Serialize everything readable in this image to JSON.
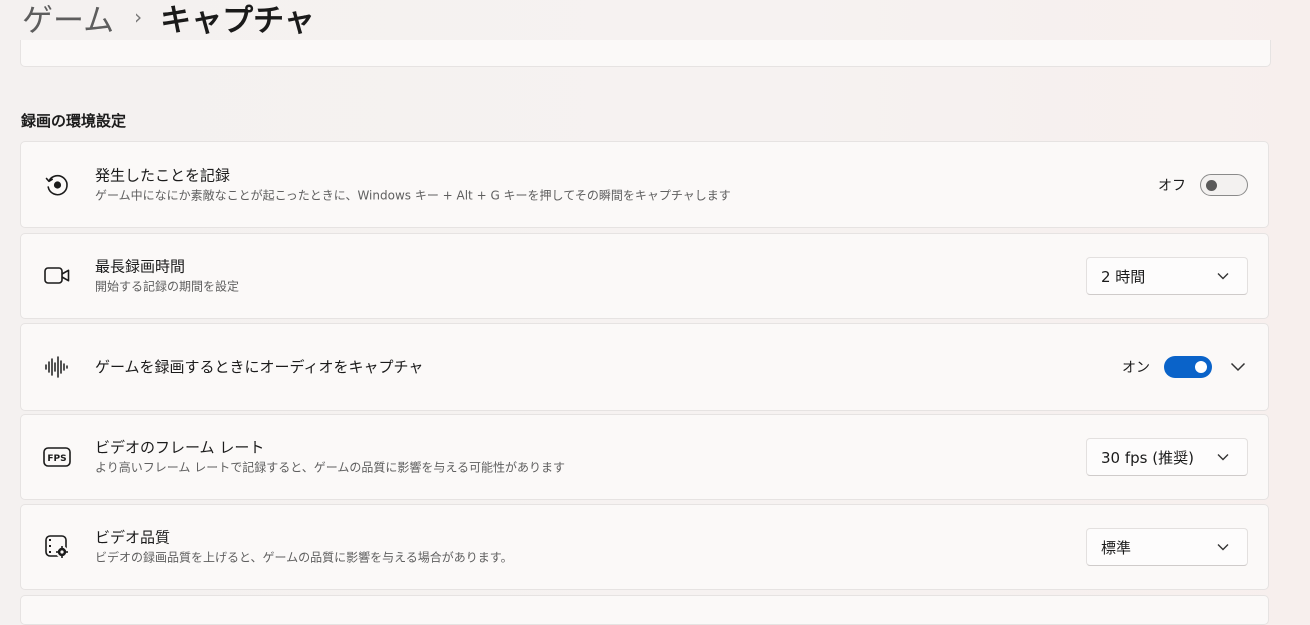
{
  "breadcrumb": {
    "parent": "ゲーム",
    "separator": "›",
    "current": "キャプチャ"
  },
  "section": {
    "title": "録画の環境設定"
  },
  "settings": [
    {
      "title": "発生したことを記録",
      "description": "ゲーム中になにか素敵なことが起こったときに、Windows キー + Alt + G キーを押してその瞬間をキャプチャします",
      "control": "toggle",
      "state_label": "オフ",
      "on": false,
      "icon": "record-history-icon"
    },
    {
      "title": "最長録画時間",
      "description": "開始する記録の期間を設定",
      "control": "dropdown",
      "value": "2 時間",
      "icon": "video-camera-icon"
    },
    {
      "title": "ゲームを録画するときにオーディオをキャプチャ",
      "control": "toggle",
      "state_label": "オン",
      "on": true,
      "icon": "audio-waveform-icon"
    },
    {
      "title": "ビデオのフレーム レート",
      "description": "より高いフレーム レートで記録すると、ゲームの品質に影響を与える可能性があります",
      "control": "dropdown",
      "value": "30 fps (推奨)",
      "icon": "fps-icon"
    },
    {
      "title": "ビデオ品質",
      "description": "ビデオの録画品質を上げると、ゲームの品質に影響を与える場合があります。",
      "control": "dropdown",
      "value": "標準",
      "icon": "video-quality-icon"
    }
  ],
  "colors": {
    "accent": "#0a63c9",
    "card_bg": "#fbf9f8",
    "border": "#e6e3e2"
  }
}
